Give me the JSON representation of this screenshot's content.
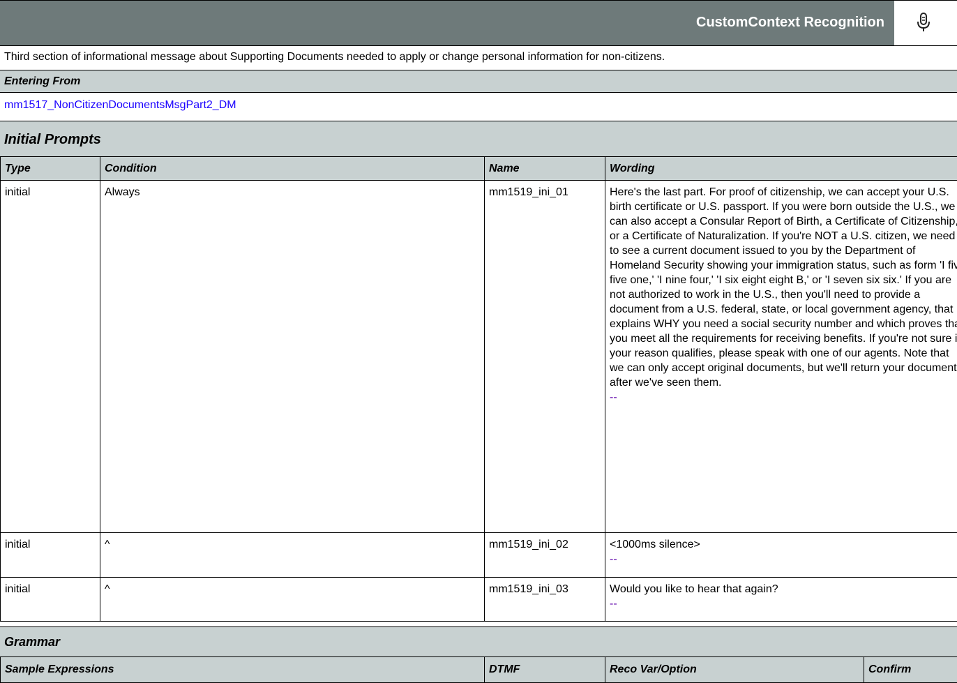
{
  "header": {
    "title": "CustomContext Recognition",
    "icon": "microphone-icon"
  },
  "description": "Third section of informational message about Supporting Documents needed to apply or change personal information for non-citizens.",
  "entering_from": {
    "label": "Entering From",
    "link": "mm1517_NonCitizenDocumentsMsgPart2_DM"
  },
  "initial_prompts": {
    "title": "Initial Prompts",
    "columns": [
      "Type",
      "Condition",
      "Name",
      "Wording"
    ],
    "rows": [
      {
        "type": "initial",
        "condition": "Always",
        "name": "mm1519_ini_01",
        "wording": "Here's the last part. For proof of citizenship, we can accept your U.S. birth certificate or U.S. passport. If you were born outside the U.S., we can also accept a Consular Report of Birth, a Certificate of Citizenship, or a Certificate of Naturalization. If you're NOT a U.S. citizen, we need to see a current document issued to you by the Department of Homeland Security showing your immigration status, such as form 'I five five one,' 'I nine four,' 'I six eight eight B,'  or 'I seven six six.' If you are not authorized to work in the U.S., then you'll need to provide a document from a U.S. federal, state, or local government agency, that explains WHY you need a social security number and which proves that you meet all the requirements for receiving benefits. If you're not sure if your reason qualifies, please speak with one of our agents. Note that we can only accept original documents, but we'll return your documents after we've seen them.",
        "marker": "--"
      },
      {
        "type": "initial",
        "condition": "^",
        "name": "mm1519_ini_02",
        "wording": "<1000ms silence>",
        "marker": "--"
      },
      {
        "type": "initial",
        "condition": "^",
        "name": "mm1519_ini_03",
        "wording": "Would you like to hear that again?",
        "marker": "--"
      }
    ]
  },
  "grammar": {
    "title": "Grammar",
    "columns": [
      "Sample Expressions",
      "DTMF",
      "Reco Var/Option",
      "Confirm"
    ]
  }
}
